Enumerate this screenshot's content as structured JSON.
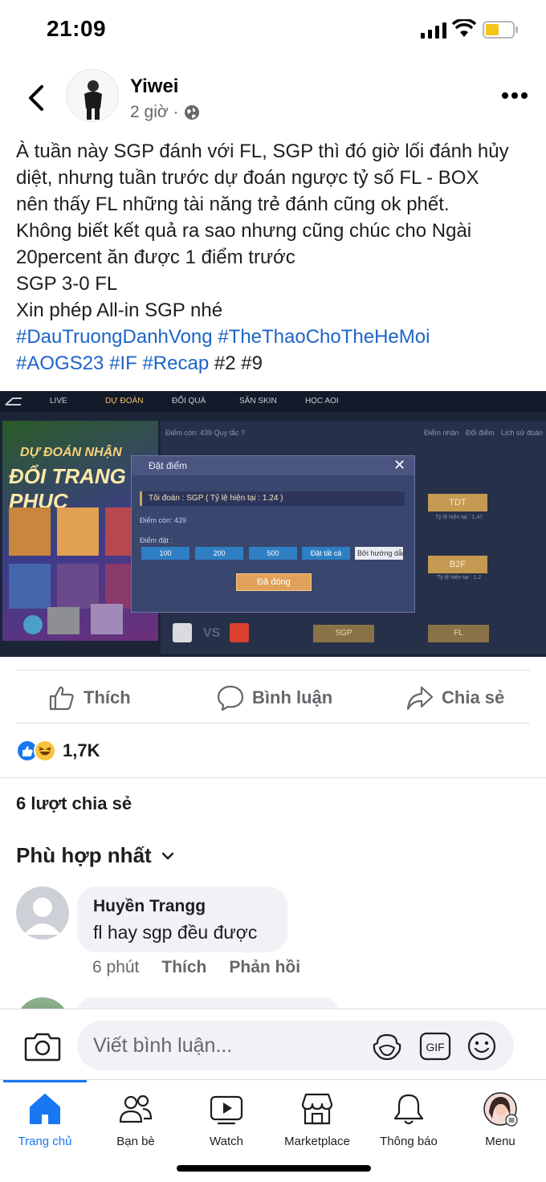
{
  "status": {
    "time": "21:09"
  },
  "post": {
    "author": "Yiwei",
    "time": "2 giờ",
    "text_lines": [
      "À tuần này SGP đánh với FL, SGP thì đó giờ lối đánh hủy",
      "diệt, nhưng tuần trước dự đoán ngược tỷ số FL - BOX",
      "nên thấy FL những tài năng trẻ đánh cũng ok phết.",
      "Không biết kết quả ra sao nhưng cũng chúc cho Ngài",
      "20percent ăn được 1 điểm trước",
      "SGP 3-0 FL",
      "Xin phép All-in SGP nhé"
    ],
    "hashtags": [
      "#DauTruongDanhVong",
      "#TheThaoChoTheHeMoi",
      "#AOGS23",
      "#IF",
      "#Recap"
    ],
    "plain_tags": [
      "#2",
      "#9"
    ]
  },
  "game_image": {
    "tabs": [
      "LIVE",
      "DỰ ĐOÁN",
      "ĐỔI QUÀ",
      "SĂN SKIN",
      "HỌC AOI"
    ],
    "side_title_1": "DỰ ĐOÁN NHẬN",
    "side_title_2": "ĐỔI TRANG PHỤC",
    "points_label": "Điểm còn:",
    "points_value": "439",
    "rules": "Quy tắc ?",
    "top_links": [
      "Điểm nhận",
      "Đổi điểm",
      "Lịch sử đoán"
    ],
    "modal_title": "Đặt điểm",
    "modal_pick": "Tôi đoán : SGP ( Tỷ lệ hiện tại : 1.24 )",
    "modal_points_label": "Điểm còn:",
    "modal_points": "439",
    "modal_bet_label": "Điểm đặt :",
    "amounts": [
      "100",
      "200",
      "500",
      "Đặt tất cả"
    ],
    "amount_input": "Bởi hướng dẫn",
    "closed_label": "Đã đóng",
    "teams_right": [
      "TDT",
      "B2F"
    ],
    "rate_tdt": "Tỷ lệ hiện tại : 1.47",
    "rate_b2f": "Tỷ lệ hiện tại : 1.2",
    "bottom_buttons": [
      "SGP",
      "FL"
    ],
    "vs": "VS"
  },
  "actions": {
    "like": "Thích",
    "comment": "Bình luận",
    "share": "Chia sẻ"
  },
  "reactions": {
    "count": "1,7K"
  },
  "shares": "6 lượt chia sẻ",
  "sort_label": "Phù hợp nhất",
  "comment": {
    "name": "Huyền Trangg",
    "text": "fl hay sgp đều được",
    "time": "6 phút",
    "like": "Thích",
    "reply": "Phản hồi"
  },
  "composer": {
    "placeholder": "Viết bình luận..."
  },
  "nav": {
    "home": "Trang chủ",
    "friends": "Bạn bè",
    "watch": "Watch",
    "marketplace": "Marketplace",
    "notifications": "Thông báo",
    "menu": "Menu"
  },
  "colors": {
    "accent": "#1877f2",
    "hashtag": "#1d64c8",
    "muted": "#65676b"
  }
}
